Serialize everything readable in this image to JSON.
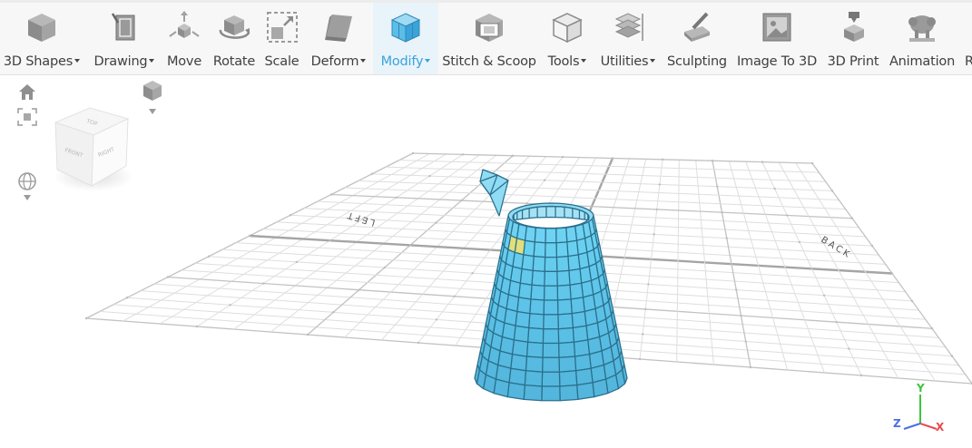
{
  "toolbar": {
    "items": [
      {
        "label": "3D Shapes",
        "icon": "cube-icon",
        "has_menu": true
      },
      {
        "label": "Drawing",
        "icon": "drawing-icon",
        "has_menu": true
      },
      {
        "label": "Move",
        "icon": "move-icon",
        "has_menu": false
      },
      {
        "label": "Rotate",
        "icon": "rotate-icon",
        "has_menu": false
      },
      {
        "label": "Scale",
        "icon": "scale-icon",
        "has_menu": false
      },
      {
        "label": "Deform",
        "icon": "deform-icon",
        "has_menu": true
      },
      {
        "label": "Modify",
        "icon": "modify-icon",
        "has_menu": true,
        "active": true
      },
      {
        "label": "Stitch & Scoop",
        "icon": "stitch-scoop-icon",
        "has_menu": false
      },
      {
        "label": "Tools",
        "icon": "tools-icon",
        "has_menu": true
      },
      {
        "label": "Utilities",
        "icon": "utilities-icon",
        "has_menu": true
      },
      {
        "label": "Sculpting",
        "icon": "sculpting-icon",
        "has_menu": false
      },
      {
        "label": "Image To 3D",
        "icon": "image-to-3d-icon",
        "has_menu": false
      },
      {
        "label": "3D Print",
        "icon": "3d-print-icon",
        "has_menu": false
      },
      {
        "label": "Animation",
        "icon": "animation-icon",
        "has_menu": false
      },
      {
        "label": "R",
        "icon": "",
        "has_menu": false
      }
    ]
  },
  "view_cube": {
    "front": "FRONT",
    "right": "RIGHT",
    "top": "TOP"
  },
  "grid_labels": {
    "left": "LEFT",
    "back": "BACK"
  },
  "axes": {
    "x": "X",
    "y": "Y",
    "z": "Z"
  },
  "colors": {
    "accent": "#39a3dc",
    "mesh_fill": "#6fd0f0",
    "mesh_line": "#2a6f8c",
    "selected_face": "#e2df7a",
    "axis_x": "#e84a4a",
    "axis_y": "#3fc43f",
    "axis_z": "#4a6ee8"
  }
}
